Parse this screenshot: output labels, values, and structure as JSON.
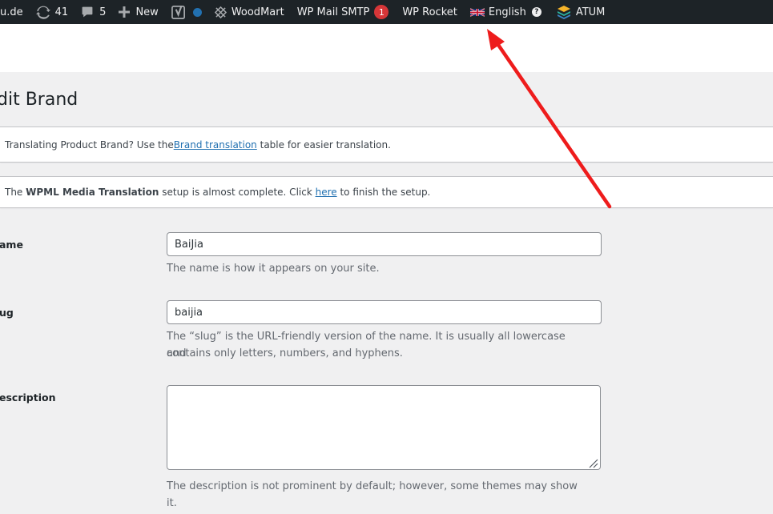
{
  "adminbar": {
    "site_fragment": "u.de",
    "updates_count": "41",
    "comments_count": "5",
    "new_label": "New",
    "woodmart_label": "WoodMart",
    "smtp_label": "WP Mail SMTP",
    "smtp_badge": "1",
    "rocket_label": "WP Rocket",
    "language_label": "English",
    "language_help": "?",
    "atum_label": "ATUM"
  },
  "page": {
    "title": "dit Brand"
  },
  "notices": {
    "brand": {
      "before": "Translating Product Brand? Use the ",
      "link": "Brand translation",
      "after": " table for easier translation."
    },
    "wpml": {
      "before": "The ",
      "bold": "WPML Media Translation",
      "middle": " setup is almost complete. Click ",
      "link": "here",
      "after": " to finish the setup."
    }
  },
  "form": {
    "name": {
      "label": "ame",
      "value": "BaiJia",
      "help": "The name is how it appears on your site."
    },
    "slug": {
      "label": "ug",
      "value": "baijia",
      "help_line1": "The “slug” is the URL-friendly version of the name. It is usually all lowercase and",
      "help_line2": "contains only letters, numbers, and hyphens."
    },
    "description": {
      "label": "escription",
      "value": "",
      "help": "The description is not prominent by default; however, some themes may show it."
    }
  },
  "colors": {
    "adminbar_bg": "#1d2327",
    "badge_red": "#d63638",
    "link_blue": "#2271b1",
    "annotation_arrow": "#ee1c1c"
  }
}
